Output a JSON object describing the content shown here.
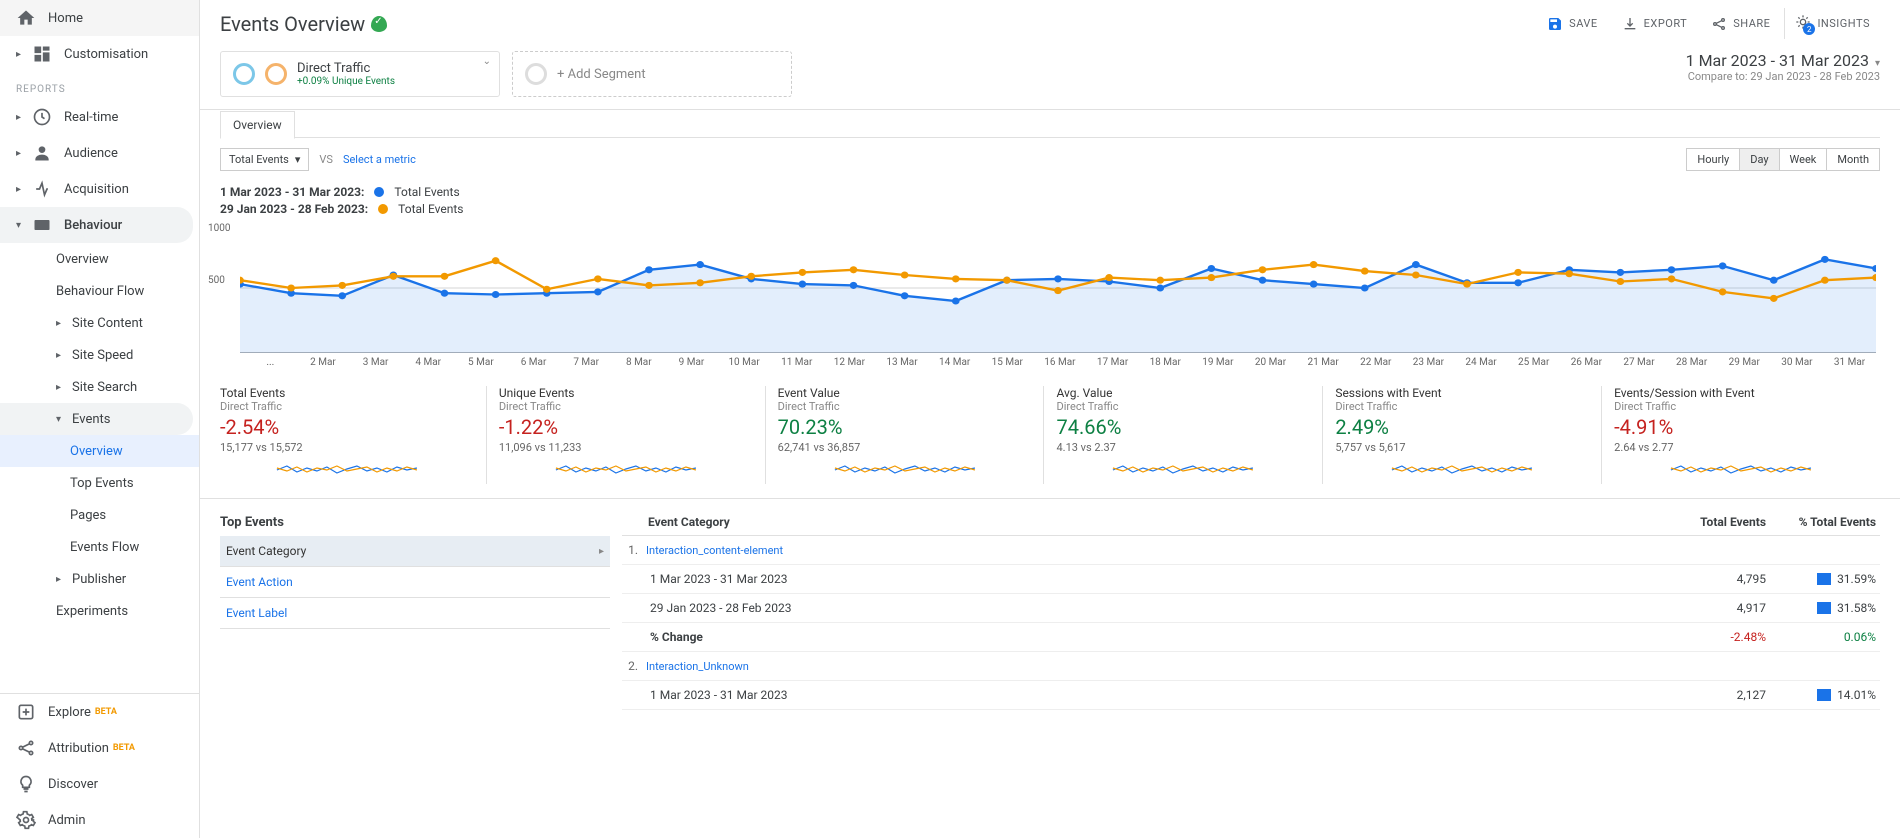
{
  "sidebar": {
    "home": "Home",
    "custom": "Customisation",
    "reports": "REPORTS",
    "realtime": "Real-time",
    "audience": "Audience",
    "acquisition": "Acquisition",
    "behaviour": "Behaviour",
    "bh_overview": "Overview",
    "bh_flow": "Behaviour Flow",
    "bh_sitecontent": "Site Content",
    "bh_sitespeed": "Site Speed",
    "bh_sitesearch": "Site Search",
    "bh_events": "Events",
    "ev_overview": "Overview",
    "ev_top": "Top Events",
    "ev_pages": "Pages",
    "ev_flow": "Events Flow",
    "bh_publisher": "Publisher",
    "bh_experiments": "Experiments",
    "explore": "Explore",
    "attribution": "Attribution",
    "discover": "Discover",
    "admin": "Admin",
    "beta": "BETA"
  },
  "header": {
    "title": "Events Overview",
    "save": "SAVE",
    "export": "EXPORT",
    "share": "SHARE",
    "insights": "INSIGHTS"
  },
  "segment": {
    "name": "Direct Traffic",
    "delta": "+0.09% Unique Events",
    "add": "+ Add Segment"
  },
  "dates": {
    "range": "1 Mar 2023 - 31 Mar 2023",
    "compare_label": "Compare to:",
    "compare_range": "29 Jan 2023 - 28 Feb 2023"
  },
  "tab_overview": "Overview",
  "controls": {
    "metric": "Total Events",
    "vs": "VS",
    "select": "Select a metric",
    "hourly": "Hourly",
    "day": "Day",
    "week": "Week",
    "month": "Month"
  },
  "legend": {
    "r1": "1 Mar 2023 - 31 Mar 2023:",
    "r2": "29 Jan 2023 - 28 Feb 2023:",
    "label": "Total Events"
  },
  "colors": {
    "blue": "#1a73e8",
    "orange": "#f29900",
    "red": "#c5221f",
    "green": "#0d8043"
  },
  "chart_data": {
    "type": "line",
    "ylim": [
      0,
      1000
    ],
    "yticks": [
      500,
      1000
    ],
    "categories": [
      "...",
      "2 Mar",
      "3 Mar",
      "4 Mar",
      "5 Mar",
      "6 Mar",
      "7 Mar",
      "8 Mar",
      "9 Mar",
      "10 Mar",
      "11 Mar",
      "12 Mar",
      "13 Mar",
      "14 Mar",
      "15 Mar",
      "16 Mar",
      "17 Mar",
      "18 Mar",
      "19 Mar",
      "20 Mar",
      "21 Mar",
      "22 Mar",
      "23 Mar",
      "24 Mar",
      "25 Mar",
      "26 Mar",
      "27 Mar",
      "28 Mar",
      "29 Mar",
      "30 Mar",
      "31 Mar"
    ],
    "series": [
      {
        "name": "Total Events (current)",
        "color": "#1a73e8",
        "values": [
          530,
          460,
          440,
          600,
          460,
          450,
          460,
          470,
          640,
          680,
          570,
          530,
          520,
          440,
          400,
          560,
          570,
          550,
          500,
          650,
          560,
          530,
          500,
          680,
          540,
          540,
          640,
          620,
          640,
          670,
          560,
          720,
          650
        ]
      },
      {
        "name": "Total Events (previous)",
        "color": "#f29900",
        "values": [
          560,
          500,
          520,
          590,
          590,
          710,
          490,
          570,
          520,
          540,
          590,
          620,
          640,
          600,
          570,
          560,
          480,
          580,
          560,
          580,
          640,
          680,
          630,
          600,
          530,
          620,
          610,
          550,
          570,
          470,
          420,
          560,
          580
        ]
      }
    ]
  },
  "metrics": [
    {
      "title": "Total Events",
      "sub": "Direct Traffic",
      "val": "-2.54%",
      "cls": "red",
      "vs": "15,177 vs 15,572"
    },
    {
      "title": "Unique Events",
      "sub": "Direct Traffic",
      "val": "-1.22%",
      "cls": "red",
      "vs": "11,096 vs 11,233"
    },
    {
      "title": "Event Value",
      "sub": "Direct Traffic",
      "val": "70.23%",
      "cls": "green",
      "vs": "62,741 vs 36,857"
    },
    {
      "title": "Avg. Value",
      "sub": "Direct Traffic",
      "val": "74.66%",
      "cls": "green",
      "vs": "4.13 vs 2.37"
    },
    {
      "title": "Sessions with Event",
      "sub": "Direct Traffic",
      "val": "2.49%",
      "cls": "green",
      "vs": "5,757 vs 5,617"
    },
    {
      "title": "Events/Session with Event",
      "sub": "Direct Traffic",
      "val": "-4.91%",
      "cls": "red",
      "vs": "2.64 vs 2.77"
    }
  ],
  "top_events": {
    "title": "Top Events",
    "dim_cat": "Event Category",
    "dim_action": "Event Action",
    "dim_label": "Event Label",
    "col_cat": "Event Category",
    "col_te": "Total Events",
    "col_pct": "% Total Events",
    "rows": [
      {
        "n": "1.",
        "cat": "Interaction_content-element",
        "period1": "1 Mar 2023 - 31 Mar 2023",
        "v1": "4,795",
        "p1": "31.59%",
        "period2": "29 Jan 2023 - 28 Feb 2023",
        "v2": "4,917",
        "p2": "31.58%",
        "change": "% Change",
        "cv": "-2.48%",
        "cp": "0.06%"
      },
      {
        "n": "2.",
        "cat": "Interaction_Unknown",
        "period1": "1 Mar 2023 - 31 Mar 2023",
        "v1": "2,127",
        "p1": "14.01%"
      }
    ]
  }
}
